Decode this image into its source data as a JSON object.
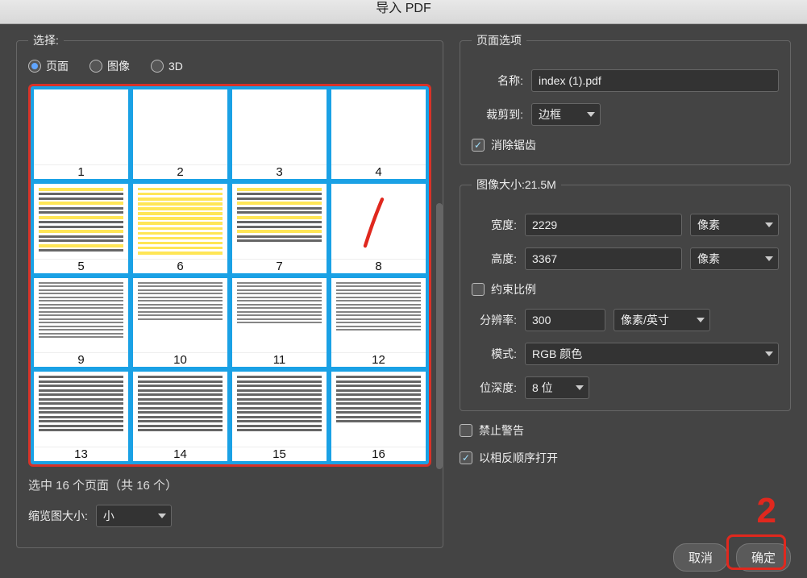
{
  "title": "导入 PDF",
  "select": {
    "legend": "选择:",
    "radios": {
      "page": "页面",
      "image": "图像",
      "threeD": "3D"
    },
    "pages": [
      1,
      2,
      3,
      4,
      5,
      6,
      7,
      8,
      9,
      10,
      11,
      12,
      13,
      14,
      15,
      16
    ],
    "status": "选中 16 个页面（共 16 个）",
    "thumb_size_label": "缩览图大小:",
    "thumb_size_value": "小"
  },
  "page_options": {
    "legend": "页面选项",
    "name_label": "名称:",
    "name_value": "index (1).pdf",
    "crop_label": "裁剪到:",
    "crop_value": "边框",
    "antialias_label": "消除锯齿"
  },
  "image_size": {
    "legend_prefix": "图像大小:",
    "legend_value": "21.5M",
    "width_label": "宽度:",
    "width_value": "2229",
    "height_label": "高度:",
    "height_value": "3367",
    "unit_px": "像素",
    "constrain_label": "约束比例",
    "res_label": "分辨率:",
    "res_value": "300",
    "res_unit": "像素/英寸",
    "mode_label": "模式:",
    "mode_value": "RGB 颜色",
    "bit_label": "位深度:",
    "bit_value": "8 位"
  },
  "bottom_checks": {
    "suppress_warnings": "禁止警告",
    "reverse_order": "以相反顺序打开"
  },
  "buttons": {
    "cancel": "取消",
    "ok": "确定"
  },
  "annotations": {
    "two": "2"
  }
}
